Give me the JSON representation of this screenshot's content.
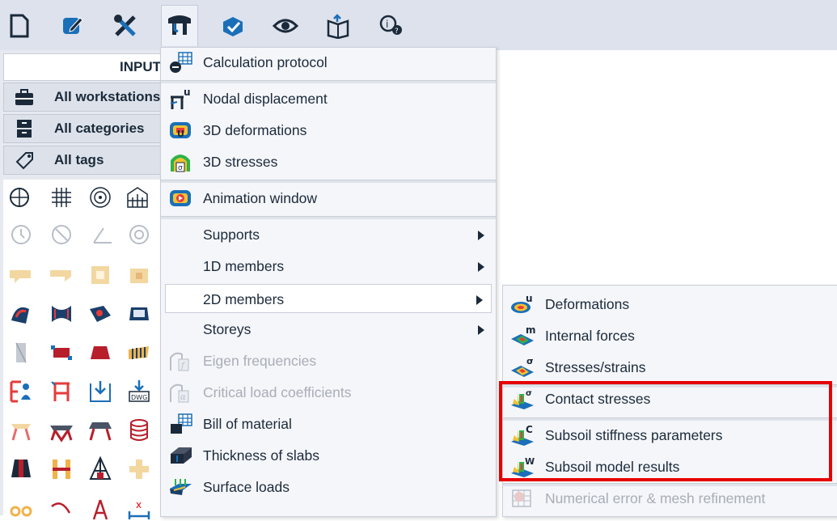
{
  "toolbar": {
    "buttons": [
      {
        "name": "new-icon"
      },
      {
        "name": "edit-icon"
      },
      {
        "name": "tools-icon"
      },
      {
        "name": "results-icon",
        "active": true
      },
      {
        "name": "check-icon"
      },
      {
        "name": "view-icon"
      },
      {
        "name": "report-icon"
      },
      {
        "name": "help-search-icon"
      }
    ]
  },
  "left_panel": {
    "header": "INPUT",
    "filters": [
      {
        "label": "All workstations",
        "icon": "briefcase-icon"
      },
      {
        "label": "All categories",
        "icon": "cabinet-icon"
      },
      {
        "label": "All tags",
        "icon": "tag-icon"
      }
    ]
  },
  "menu": {
    "items": [
      {
        "label": "Calculation protocol",
        "icon": "calculation-protocol-icon"
      },
      {
        "label": "Nodal displacement",
        "icon": "nodal-displacement-icon"
      },
      {
        "label": "3D deformations",
        "icon": "3d-deformations-icon"
      },
      {
        "label": "3D stresses",
        "icon": "3d-stresses-icon"
      },
      {
        "label": "Animation window",
        "icon": "animation-window-icon"
      },
      {
        "label": "Supports",
        "has_submenu": true
      },
      {
        "label": "1D members",
        "has_submenu": true
      },
      {
        "label": "2D members",
        "has_submenu": true,
        "selected": true
      },
      {
        "label": "Storeys",
        "has_submenu": true
      },
      {
        "label": "Eigen frequencies",
        "disabled": true,
        "icon": "eigen-frequencies-icon"
      },
      {
        "label": "Critical load coefficients",
        "disabled": true,
        "icon": "critical-load-icon"
      },
      {
        "label": "Bill of material",
        "icon": "bill-of-material-icon"
      },
      {
        "label": "Thickness of slabs",
        "icon": "thickness-of-slabs-icon"
      },
      {
        "label": "Surface loads",
        "icon": "surface-loads-icon"
      }
    ]
  },
  "submenu": {
    "items": [
      {
        "label": "Deformations",
        "icon": "deformations-icon"
      },
      {
        "label": "Internal forces",
        "icon": "internal-forces-icon"
      },
      {
        "label": "Stresses/strains",
        "icon": "stresses-strains-icon"
      },
      {
        "label": "Contact stresses",
        "icon": "contact-stresses-icon",
        "highlighted": true
      },
      {
        "label": "Subsoil stiffness parameters",
        "icon": "subsoil-stiffness-icon",
        "highlighted": true
      },
      {
        "label": "Subsoil model results",
        "icon": "subsoil-results-icon",
        "highlighted": true
      },
      {
        "label": "Numerical error & mesh refinement",
        "icon": "numerical-error-icon",
        "disabled": true
      }
    ]
  },
  "colors": {
    "toolbar_bg": "#dde2ed",
    "highlight_box": "#e60000",
    "icon_blue": "#1a6fb8",
    "icon_dark": "#1b2a3a"
  }
}
